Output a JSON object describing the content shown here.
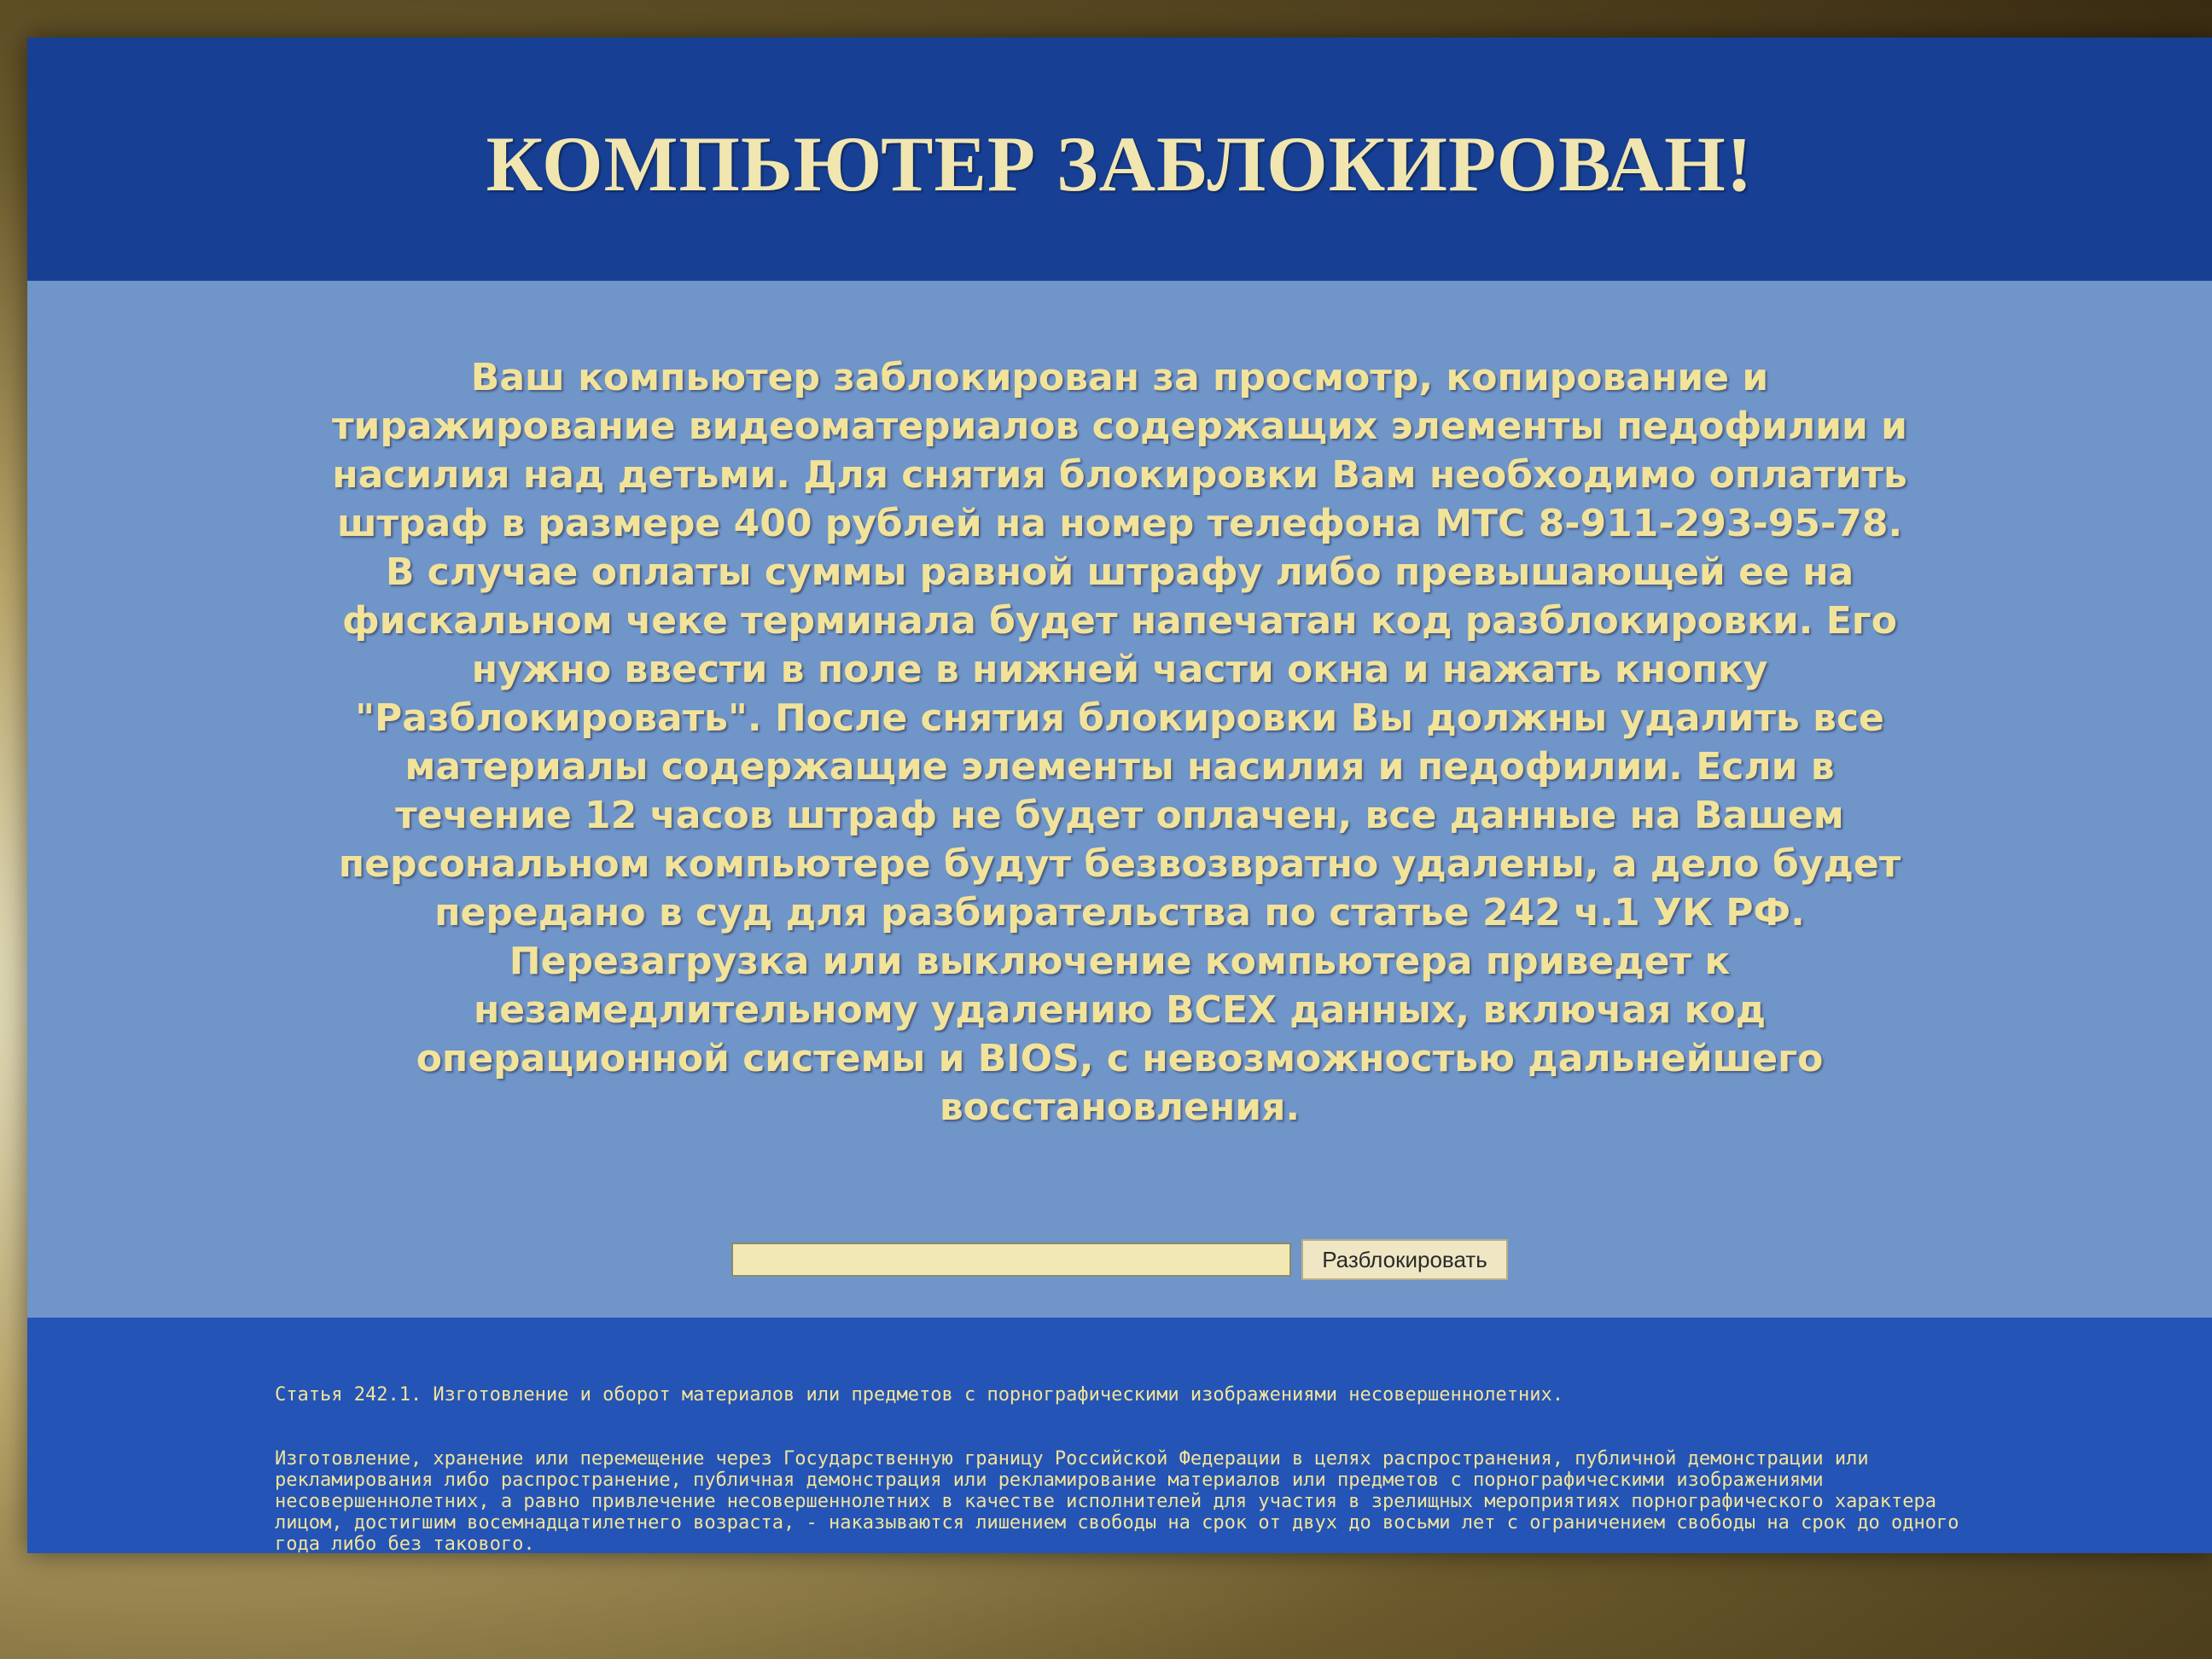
{
  "header": {
    "title": "КОМПЬЮТЕР ЗАБЛОКИРОВАН!"
  },
  "message": {
    "main": "Ваш компьютер заблокирован за просмотр, копирование и тиражирование видеоматериалов содержащих элементы педофилии и насилия над детьми. Для снятия блокировки Вам необходимо оплатить штраф в размере 400 рублей на номер телефона МТС 8-911-293-95-78. В случае оплаты суммы равной штрафу либо превышающей ее на фискальном чеке терминала будет напечатан код разблокировки. Его нужно ввести в поле в нижней части окна и нажать кнопку \"Разблокировать\". После снятия блокировки Вы должны удалить все материалы содержащие элементы насилия и педофилии. Если в течение 12 часов штраф не будет оплачен, все данные на Вашем персональном компьютере будут безвозвратно удалены, а дело будет передано в суд для разбирательства по статье 242 ч.1 УК РФ.",
    "warning": "Перезагрузка или выключение компьютера приведет к незамедлительному удалению ВСЕХ данных, включая код операционной системы и BIOS, с невозможностью дальнейшего восстановления."
  },
  "unlock": {
    "input_value": "",
    "button_label": "Разблокировать"
  },
  "footer": {
    "article_title": "Статья 242.1. Изготовление и оборот материалов или предметов с порнографическими изображениями несовершеннолетних.",
    "article_body": "Изготовление, хранение или перемещение через Государственную границу Российской Федерации в целях распространения, публичной демонстрации или рекламирования либо распространение, публичная демонстрация или рекламирование материалов или предметов с порнографическими изображениями несовершеннолетних, а равно привлечение несовершеннолетних в качестве исполнителей для участия в зрелищных мероприятиях порнографического характера лицом, достигшим восемнадцатилетнего возраста, - наказываются лишением свободы на срок от двух до восьми лет с ограничением свободы на срок до одного года либо без такового."
  },
  "colors": {
    "header_band": "#173f93",
    "body_background": "#6f95c9",
    "footer_band": "#2454b5",
    "text_yellow": "#f2e39a"
  }
}
